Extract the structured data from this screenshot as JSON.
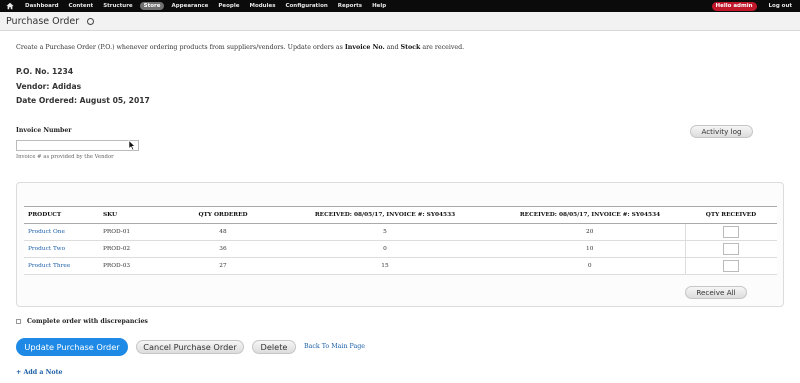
{
  "toolbar": {
    "items": [
      "Dashboard",
      "Content",
      "Structure",
      "Store",
      "Appearance",
      "People",
      "Modules",
      "Configuration",
      "Reports",
      "Help"
    ],
    "active_item": "Store",
    "user_label": "Hello admin",
    "logout_label": "Log out"
  },
  "page": {
    "title": "Purchase Order"
  },
  "intro": {
    "text_before": "Create a Purchase Order (P.O.) whenever ordering products from suppliers/vendors. Update orders as ",
    "bold1": "Invoice No.",
    "text_mid": " and ",
    "bold2": "Stock",
    "text_after": " are received."
  },
  "po": {
    "number": "P.O. No. 1234",
    "vendor": "Vendor: Adidas",
    "date": "Date Ordered: August 05, 2017"
  },
  "invoice": {
    "label": "Invoice Number",
    "value": "",
    "help": "Invoice # as provided by the Vendor"
  },
  "buttons": {
    "activity_log": "Activity log",
    "receive_all": "Receive All",
    "update": "Update Purchase Order",
    "cancel": "Cancel Purchase Order",
    "delete": "Delete",
    "back": "Back To Main Page",
    "add_note": "+ Add a Note"
  },
  "table": {
    "headers": [
      "PRODUCT",
      "SKU",
      "QTY ORDERED",
      "RECEIVED: 08/05/17, INVOICE #: SY04533",
      "RECEIVED: 08/05/17, INVOICE #: SY04534",
      "QTY RECEIVED"
    ],
    "rows": [
      {
        "product": "Product One",
        "sku": "PROD-01",
        "qty_ordered": "48",
        "received1": "5",
        "received2": "20",
        "qty_received": ""
      },
      {
        "product": "Product Two",
        "sku": "PROD-02",
        "qty_ordered": "36",
        "received1": "0",
        "received2": "10",
        "qty_received": ""
      },
      {
        "product": "Product Three",
        "sku": "PROD-03",
        "qty_ordered": "27",
        "received1": "15",
        "received2": "0",
        "qty_received": ""
      }
    ]
  },
  "discrepancy": {
    "label": "Complete order with discrepancies",
    "checked": false
  },
  "colors": {
    "primary": "#1f8ae6",
    "link": "#1a5ea8",
    "user_badge": "#c0182a",
    "toolbar_bg": "#0b0b0b"
  },
  "icons": {
    "home": "home-icon",
    "star": "star-icon"
  }
}
